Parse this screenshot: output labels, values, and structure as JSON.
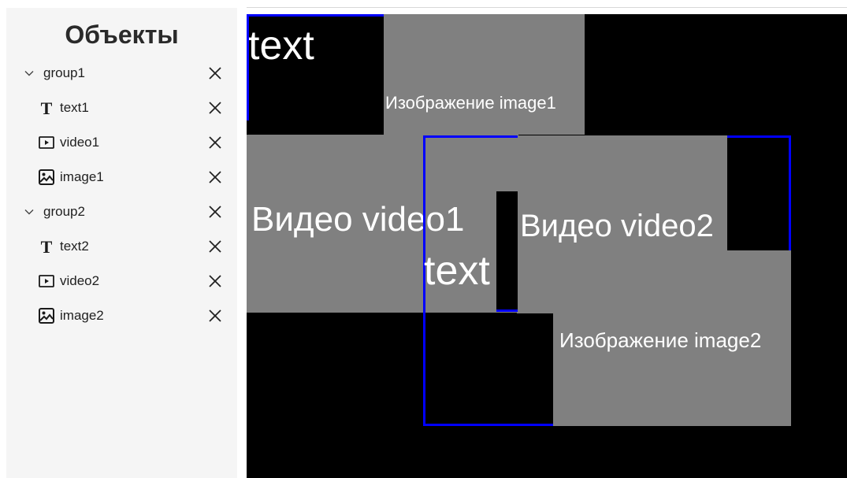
{
  "sidebar": {
    "title": "Объекты",
    "items": [
      {
        "type": "group",
        "label": "group1",
        "icon": "chevron-down-icon",
        "close_icon": "close-icon"
      },
      {
        "type": "text",
        "label": "text1",
        "icon": "text-type-icon",
        "close_icon": "close-icon"
      },
      {
        "type": "video",
        "label": "video1",
        "icon": "video-icon",
        "close_icon": "close-icon"
      },
      {
        "type": "image",
        "label": "image1",
        "icon": "image-icon",
        "close_icon": "close-icon"
      },
      {
        "type": "group",
        "label": "group2",
        "icon": "chevron-down-icon",
        "close_icon": "close-icon"
      },
      {
        "type": "text",
        "label": "text2",
        "icon": "text-type-icon",
        "close_icon": "close-icon"
      },
      {
        "type": "video",
        "label": "video2",
        "icon": "video-icon",
        "close_icon": "close-icon"
      },
      {
        "type": "image",
        "label": "image2",
        "icon": "image-icon",
        "close_icon": "close-icon"
      }
    ]
  },
  "canvas": {
    "background": "#000000",
    "placeholder_color": "#808080",
    "selection_color": "#0000ff",
    "text1": "text",
    "image1_label": "Изображение image1",
    "video1_label": "Видео video1",
    "video2_label": "Видео video2",
    "text2": "text",
    "image2_label": "Изображение image2"
  }
}
